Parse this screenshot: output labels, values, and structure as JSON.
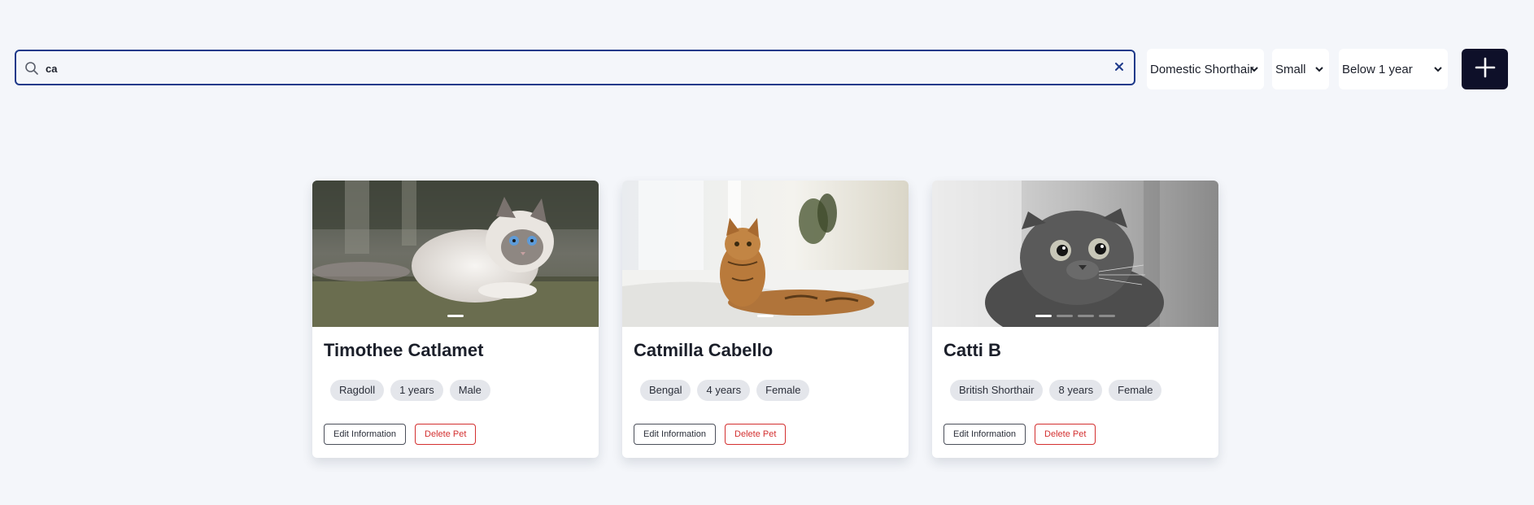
{
  "search": {
    "value": "ca",
    "clear_icon": "close-icon",
    "icon": "search-icon"
  },
  "filters": {
    "breed": "Domestic Shorthair",
    "size": "Small",
    "age": "Below 1 year"
  },
  "add_button": {
    "icon": "plus-icon"
  },
  "colors": {
    "accent": "#0e1029",
    "search_border": "#1e3a8a",
    "delete": "#d32f2f",
    "background": "#f4f6fa"
  },
  "pets": [
    {
      "name": "Timothee Catlamet",
      "breed": "Ragdoll",
      "age": "1 years",
      "gender": "Male",
      "edit_label": "Edit Information",
      "delete_label": "Delete Pet",
      "photo_count": 1
    },
    {
      "name": "Catmilla Cabello",
      "breed": "Bengal",
      "age": "4 years",
      "gender": "Female",
      "edit_label": "Edit Information",
      "delete_label": "Delete Pet",
      "photo_count": 1
    },
    {
      "name": "Catti B",
      "breed": "British Shorthair",
      "age": "8 years",
      "gender": "Female",
      "edit_label": "Edit Information",
      "delete_label": "Delete Pet",
      "photo_count": 4
    }
  ]
}
